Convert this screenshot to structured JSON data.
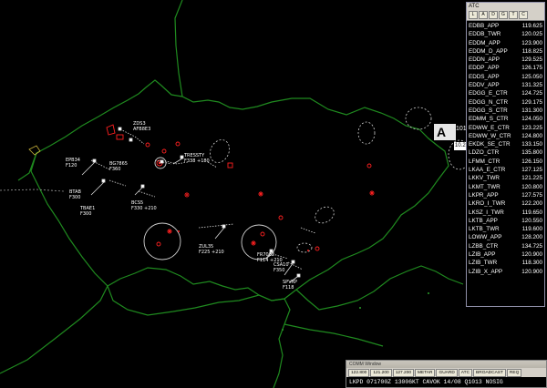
{
  "atc_panel": {
    "title": "ATC",
    "filters": [
      "L",
      "A",
      "D",
      "G",
      "T",
      "C"
    ],
    "stations": [
      {
        "callsign": "EDBB_APP",
        "freq": "119.625"
      },
      {
        "callsign": "EDDB_TWR",
        "freq": "120.025"
      },
      {
        "callsign": "EDDM_APP",
        "freq": "123.900"
      },
      {
        "callsign": "EDDM_D_APP",
        "freq": "118.825"
      },
      {
        "callsign": "EDDN_APP",
        "freq": "129.525"
      },
      {
        "callsign": "EDDP_APP",
        "freq": "126.175"
      },
      {
        "callsign": "EDDS_APP",
        "freq": "125.050"
      },
      {
        "callsign": "EDDV_APP",
        "freq": "131.325"
      },
      {
        "callsign": "EDGG_E_CTR",
        "freq": "124.725"
      },
      {
        "callsign": "EDGG_N_CTR",
        "freq": "129.175"
      },
      {
        "callsign": "EDGG_S_CTR",
        "freq": "131.300"
      },
      {
        "callsign": "EDMM_S_CTR",
        "freq": "124.050"
      },
      {
        "callsign": "EDWW_E_CTR",
        "freq": "123.225"
      },
      {
        "callsign": "EDWW_W_CTR",
        "freq": "124.800"
      },
      {
        "callsign": "EKDK_SE_CTR",
        "freq": "133.150"
      },
      {
        "callsign": "LDZO_CTR",
        "freq": "135.800"
      },
      {
        "callsign": "LFMM_CTR",
        "freq": "126.150"
      },
      {
        "callsign": "LKAA_E_CTR",
        "freq": "127.125"
      },
      {
        "callsign": "LKKV_TWR",
        "freq": "121.225"
      },
      {
        "callsign": "LKMT_TWR",
        "freq": "120.800"
      },
      {
        "callsign": "LKPR_APP",
        "freq": "127.575"
      },
      {
        "callsign": "LKRO_I_TWR",
        "freq": "122.200"
      },
      {
        "callsign": "LKSZ_I_TWR",
        "freq": "119.650"
      },
      {
        "callsign": "LKTB_APP",
        "freq": "120.550"
      },
      {
        "callsign": "LKTB_TWR",
        "freq": "119.600"
      },
      {
        "callsign": "LOWW_APP",
        "freq": "128.200"
      },
      {
        "callsign": "LZBB_CTR",
        "freq": "134.725"
      },
      {
        "callsign": "LZIB_APP",
        "freq": "120.900"
      },
      {
        "callsign": "LZIB_TWR",
        "freq": "118.300"
      },
      {
        "callsign": "LZIB_X_APP",
        "freq": "120.900"
      }
    ]
  },
  "atis": {
    "letter": "A",
    "qnh_top": "101",
    "qnh_bottom": "10.26"
  },
  "info_window": {
    "title": "COMM Window",
    "tabs": [
      "122.800",
      "121.200",
      "127.200",
      "METAR",
      "GUARD",
      "ATC",
      "BROADCAST",
      "REQ"
    ],
    "metar": "LKPD 071700Z 13006KT CAVOK 14/08 Q1013 NOSIG"
  },
  "aircraft": [
    {
      "callsign": "ZDS3",
      "line2": "AFB8E3"
    },
    {
      "callsign": "TRESSTY",
      "line2": "F338 +180"
    },
    {
      "callsign": "BG7865",
      "line2": "F360"
    },
    {
      "callsign": "EPB34",
      "line2": "F120"
    },
    {
      "callsign": "BTAB",
      "line2": "F300"
    },
    {
      "callsign": "TBAE1",
      "line2": "F300"
    },
    {
      "callsign": "BCS5",
      "line2": "F330 +210"
    },
    {
      "callsign": "ZUL35",
      "line2": "F225 +210"
    },
    {
      "callsign": "FR7082",
      "line2": "F114 +210"
    },
    {
      "callsign": "CSA10",
      "line2": "F350"
    },
    {
      "callsign": "SPVXP",
      "line2": "F118"
    }
  ],
  "colors": {
    "border": "#1f8a1f",
    "blip": "#ff2020",
    "panel_border": "#8f8fa8"
  }
}
